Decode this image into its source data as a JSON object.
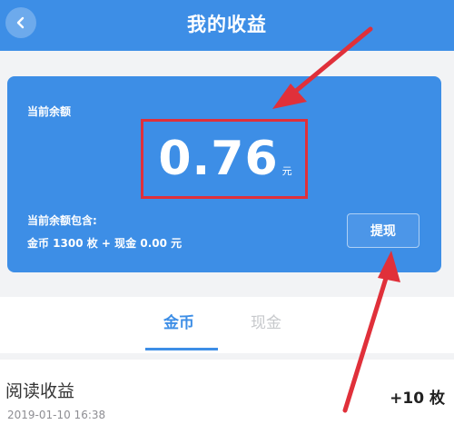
{
  "header": {
    "title": "我的收益",
    "back_icon": "chevron-left-icon"
  },
  "balance": {
    "label": "当前余额",
    "amount": "0.76",
    "unit": "元",
    "contains_label": "当前余额包含:",
    "contains_detail": "金币 1300 枚 + 现金 0.00 元",
    "withdraw_label": "提现"
  },
  "tabs": [
    {
      "label": "金币",
      "active": true
    },
    {
      "label": "现金",
      "active": false
    }
  ],
  "records": [
    {
      "title": "阅读收益",
      "time": "2019-01-10 16:38",
      "amount": "+10 枚"
    }
  ],
  "colors": {
    "primary": "#3d8ee6",
    "annotation": "#e0303a",
    "background": "#f2f3f5"
  }
}
